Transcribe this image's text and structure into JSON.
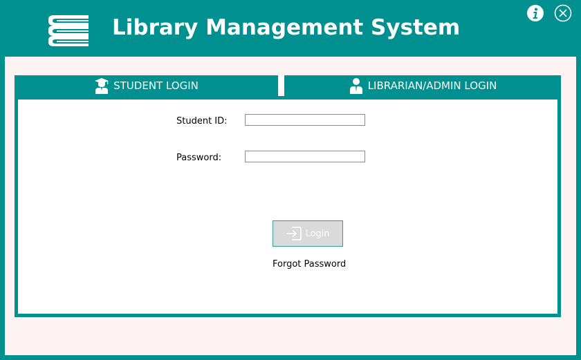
{
  "window": {
    "title": "Library Management System"
  },
  "icons": {
    "logo": "books-stack-icon",
    "info": "info-icon",
    "close": "close-icon",
    "student_tab": "graduate-icon",
    "admin_tab": "user-icon",
    "login": "login-icon"
  },
  "tabs": [
    {
      "label": "STUDENT LOGIN"
    },
    {
      "label": "LIBRARIAN/ADMIN LOGIN"
    }
  ],
  "form": {
    "student_id_label": "Student ID:",
    "student_id_value": "",
    "password_label": "Password:",
    "password_value": "",
    "login_label": "Login",
    "forgot_label": "Forgot Password"
  },
  "colors": {
    "accent": "#00908f",
    "body_bg": "#fdf3f3",
    "panel_bg": "#ffffff",
    "button_bg": "#dadada"
  }
}
